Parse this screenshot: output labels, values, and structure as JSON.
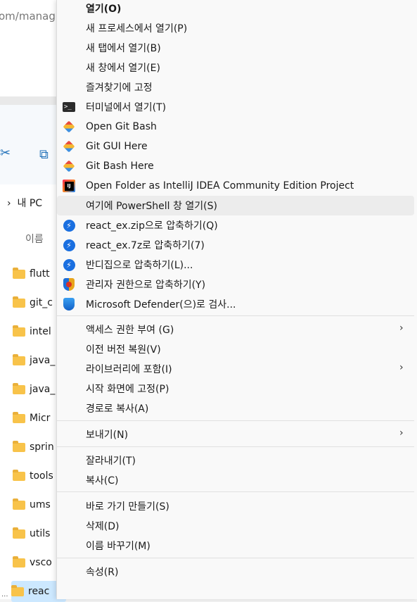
{
  "explorer": {
    "address_fragment": "om/manag",
    "nav_this_pc": "내 PC",
    "column_name": "이름",
    "files": [
      "flutt",
      "git_c",
      "intel",
      "java_",
      "java_",
      "Micr",
      "sprin",
      "tools",
      "ums",
      "utils",
      "vsco",
      "reac"
    ],
    "selected_file": "reac"
  },
  "menu": {
    "items": [
      {
        "label": "열기(O)",
        "icon": "",
        "bold": true
      },
      {
        "label": "새 프로세스에서 열기(P)",
        "icon": ""
      },
      {
        "label": "새 탭에서 열기(B)",
        "icon": ""
      },
      {
        "label": "새 창에서 열기(E)",
        "icon": ""
      },
      {
        "label": "즐겨찾기에 고정",
        "icon": ""
      },
      {
        "label": "터미널에서 열기(T)",
        "icon": "terminal-icon"
      },
      {
        "label": "Open Git Bash",
        "icon": "git-icon"
      },
      {
        "label": "Git GUI Here",
        "icon": "git-icon"
      },
      {
        "label": "Git Bash Here",
        "icon": "git-icon"
      },
      {
        "label": "Open Folder as IntelliJ IDEA Community Edition Project",
        "icon": "intellij-icon"
      },
      {
        "label": "여기에 PowerShell 창 열기(S)",
        "icon": "",
        "highlighted": true
      },
      {
        "label": "react_ex.zip으로 압축하기(Q)",
        "icon": "bandizip-icon"
      },
      {
        "label": "react_ex.7z로 압축하기(7)",
        "icon": "bandizip-icon"
      },
      {
        "label": "반디집으로 압축하기(L)...",
        "icon": "bandizip-icon"
      },
      {
        "label": "관리자 권한으로 압축하기(Y)",
        "icon": "admin-shield-icon"
      },
      {
        "label": "Microsoft Defender(으)로 검사...",
        "icon": "defender-icon"
      },
      {
        "label": "액세스 권한 부여 (G)",
        "icon": "",
        "submenu": true
      },
      {
        "label": "이전 버전 복원(V)",
        "icon": ""
      },
      {
        "label": "라이브러리에 포함(I)",
        "icon": "",
        "submenu": true
      },
      {
        "label": "시작 화면에 고정(P)",
        "icon": ""
      },
      {
        "label": "경로로 복사(A)",
        "icon": ""
      },
      {
        "label": "보내기(N)",
        "icon": "",
        "submenu": true
      },
      {
        "label": "잘라내기(T)",
        "icon": ""
      },
      {
        "label": "복사(C)",
        "icon": ""
      },
      {
        "label": "바로 가기 만들기(S)",
        "icon": ""
      },
      {
        "label": "삭제(D)",
        "icon": ""
      },
      {
        "label": "이름 바꾸기(M)",
        "icon": ""
      },
      {
        "label": "속성(R)",
        "icon": ""
      }
    ],
    "submenu_arrow": "›"
  },
  "colors": {
    "menu_bg": "#f9f9f9",
    "highlight": "#ececec",
    "selection": "#cce8ff",
    "folder": "#f8c34a"
  }
}
